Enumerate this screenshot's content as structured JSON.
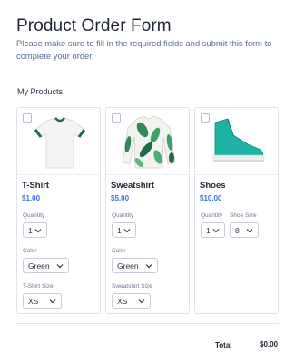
{
  "form": {
    "title": "Product Order Form",
    "subtitle": "Please make sure to fill in the required fields and submit this form to complete your order."
  },
  "products_section": {
    "label": "My Products"
  },
  "products": [
    {
      "name": "T-Shirt",
      "price": "$1.00",
      "image": "white-tshirt-with-green-trim",
      "quantity_label": "Quantity",
      "quantity_value": "1",
      "color_label": "Color",
      "color_value": "Green",
      "size_label": "T-Shirt Size",
      "size_value": "XS"
    },
    {
      "name": "Sweatshirt",
      "price": "$5.00",
      "image": "leaf-print-sweatshirt",
      "quantity_label": "Quantity",
      "quantity_value": "1",
      "color_label": "Color",
      "color_value": "Green",
      "size_label": "Sweatshirt Size",
      "size_value": "XS"
    },
    {
      "name": "Shoes",
      "price": "$10.00",
      "image": "teal-high-top-sneaker",
      "quantity_label": "Quantity",
      "quantity_value": "1",
      "size_label": "Shoe Size",
      "size_value": "8"
    }
  ],
  "summary": {
    "total_label": "Total",
    "total_value": "$0.00"
  },
  "colors": {
    "accent_price": "#3b70e0",
    "product_green": "#1e7a4f",
    "sneaker_teal": "#1fb3a5"
  }
}
